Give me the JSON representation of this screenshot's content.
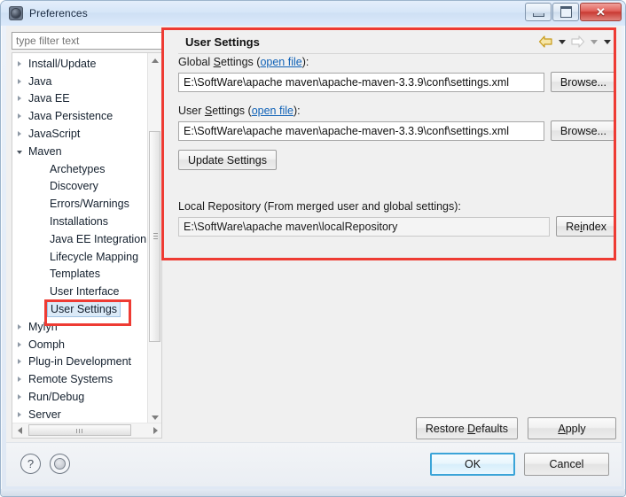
{
  "window": {
    "title": "Preferences",
    "icon": "preferences-gear-icon",
    "minimize_label": "Minimize",
    "maximize_label": "Maximize",
    "close_label": "Close",
    "close_glyph": "✕"
  },
  "filter": {
    "placeholder": "type filter text",
    "value": ""
  },
  "tree": {
    "items": [
      {
        "label": "Install/Update",
        "indent": 0,
        "state": "collapsed",
        "selected": false
      },
      {
        "label": "Java",
        "indent": 0,
        "state": "collapsed",
        "selected": false
      },
      {
        "label": "Java EE",
        "indent": 0,
        "state": "collapsed",
        "selected": false
      },
      {
        "label": "Java Persistence",
        "indent": 0,
        "state": "collapsed",
        "selected": false
      },
      {
        "label": "JavaScript",
        "indent": 0,
        "state": "collapsed",
        "selected": false
      },
      {
        "label": "Maven",
        "indent": 0,
        "state": "expanded",
        "selected": false
      },
      {
        "label": "Archetypes",
        "indent": 1,
        "state": "leaf",
        "selected": false
      },
      {
        "label": "Discovery",
        "indent": 1,
        "state": "leaf",
        "selected": false
      },
      {
        "label": "Errors/Warnings",
        "indent": 1,
        "state": "leaf",
        "selected": false
      },
      {
        "label": "Installations",
        "indent": 1,
        "state": "leaf",
        "selected": false
      },
      {
        "label": "Java EE Integration",
        "indent": 1,
        "state": "leaf",
        "selected": false
      },
      {
        "label": "Lifecycle Mapping",
        "indent": 1,
        "state": "leaf",
        "selected": false
      },
      {
        "label": "Templates",
        "indent": 1,
        "state": "leaf",
        "selected": false
      },
      {
        "label": "User Interface",
        "indent": 1,
        "state": "leaf",
        "selected": false
      },
      {
        "label": "User Settings",
        "indent": 1,
        "state": "leaf",
        "selected": true
      },
      {
        "label": "Mylyn",
        "indent": 0,
        "state": "collapsed",
        "selected": false
      },
      {
        "label": "Oomph",
        "indent": 0,
        "state": "collapsed",
        "selected": false
      },
      {
        "label": "Plug-in Development",
        "indent": 0,
        "state": "collapsed",
        "selected": false
      },
      {
        "label": "Remote Systems",
        "indent": 0,
        "state": "collapsed",
        "selected": false
      },
      {
        "label": "Run/Debug",
        "indent": 0,
        "state": "collapsed",
        "selected": false
      },
      {
        "label": "Server",
        "indent": 0,
        "state": "collapsed",
        "selected": false
      }
    ]
  },
  "panel": {
    "title": "User Settings",
    "toolbar": {
      "back_icon": "back-arrow-icon",
      "back_menu_icon": "back-dropdown-icon",
      "forward_icon": "forward-arrow-icon",
      "forward_menu_icon": "forward-dropdown-icon",
      "menu_icon": "view-menu-icon"
    },
    "global_settings": {
      "label_prefix": "Global ",
      "label_mnemonic": "S",
      "label_rest": "ettings ",
      "link_open": "(",
      "link_text": "open file",
      "link_close": "):",
      "value": "E:\\SoftWare\\apache maven\\apache-maven-3.3.9\\conf\\settings.xml",
      "browse_label": "Browse..."
    },
    "user_settings": {
      "label_prefix": "User ",
      "label_mnemonic": "S",
      "label_rest": "ettings ",
      "link_open": "(",
      "link_text": "open file",
      "link_close": "):",
      "value": "E:\\SoftWare\\apache maven\\apache-maven-3.3.9\\conf\\settings.xml",
      "browse_label": "Browse..."
    },
    "update_settings_label": "Update Settings",
    "local_repository": {
      "label": "Local Repository (From merged user and global settings):",
      "value": "E:\\SoftWare\\apache maven\\localRepository",
      "reindex_label_prefix": "Re",
      "reindex_label_mnemonic": "i",
      "reindex_label_rest": "ndex"
    },
    "restore_defaults": {
      "prefix": "Restore ",
      "mnemonic": "D",
      "rest": "efaults"
    },
    "apply": {
      "prefix": "",
      "mnemonic": "A",
      "rest": "pply"
    }
  },
  "footer": {
    "help_icon": "help-question-icon",
    "info_icon": "oomph-recorder-icon",
    "ok_label": "OK",
    "cancel_label": "Cancel"
  },
  "annotations": {
    "panel_highlight_color": "#ee3b33",
    "tree_highlight_color": "#ee3b33"
  }
}
